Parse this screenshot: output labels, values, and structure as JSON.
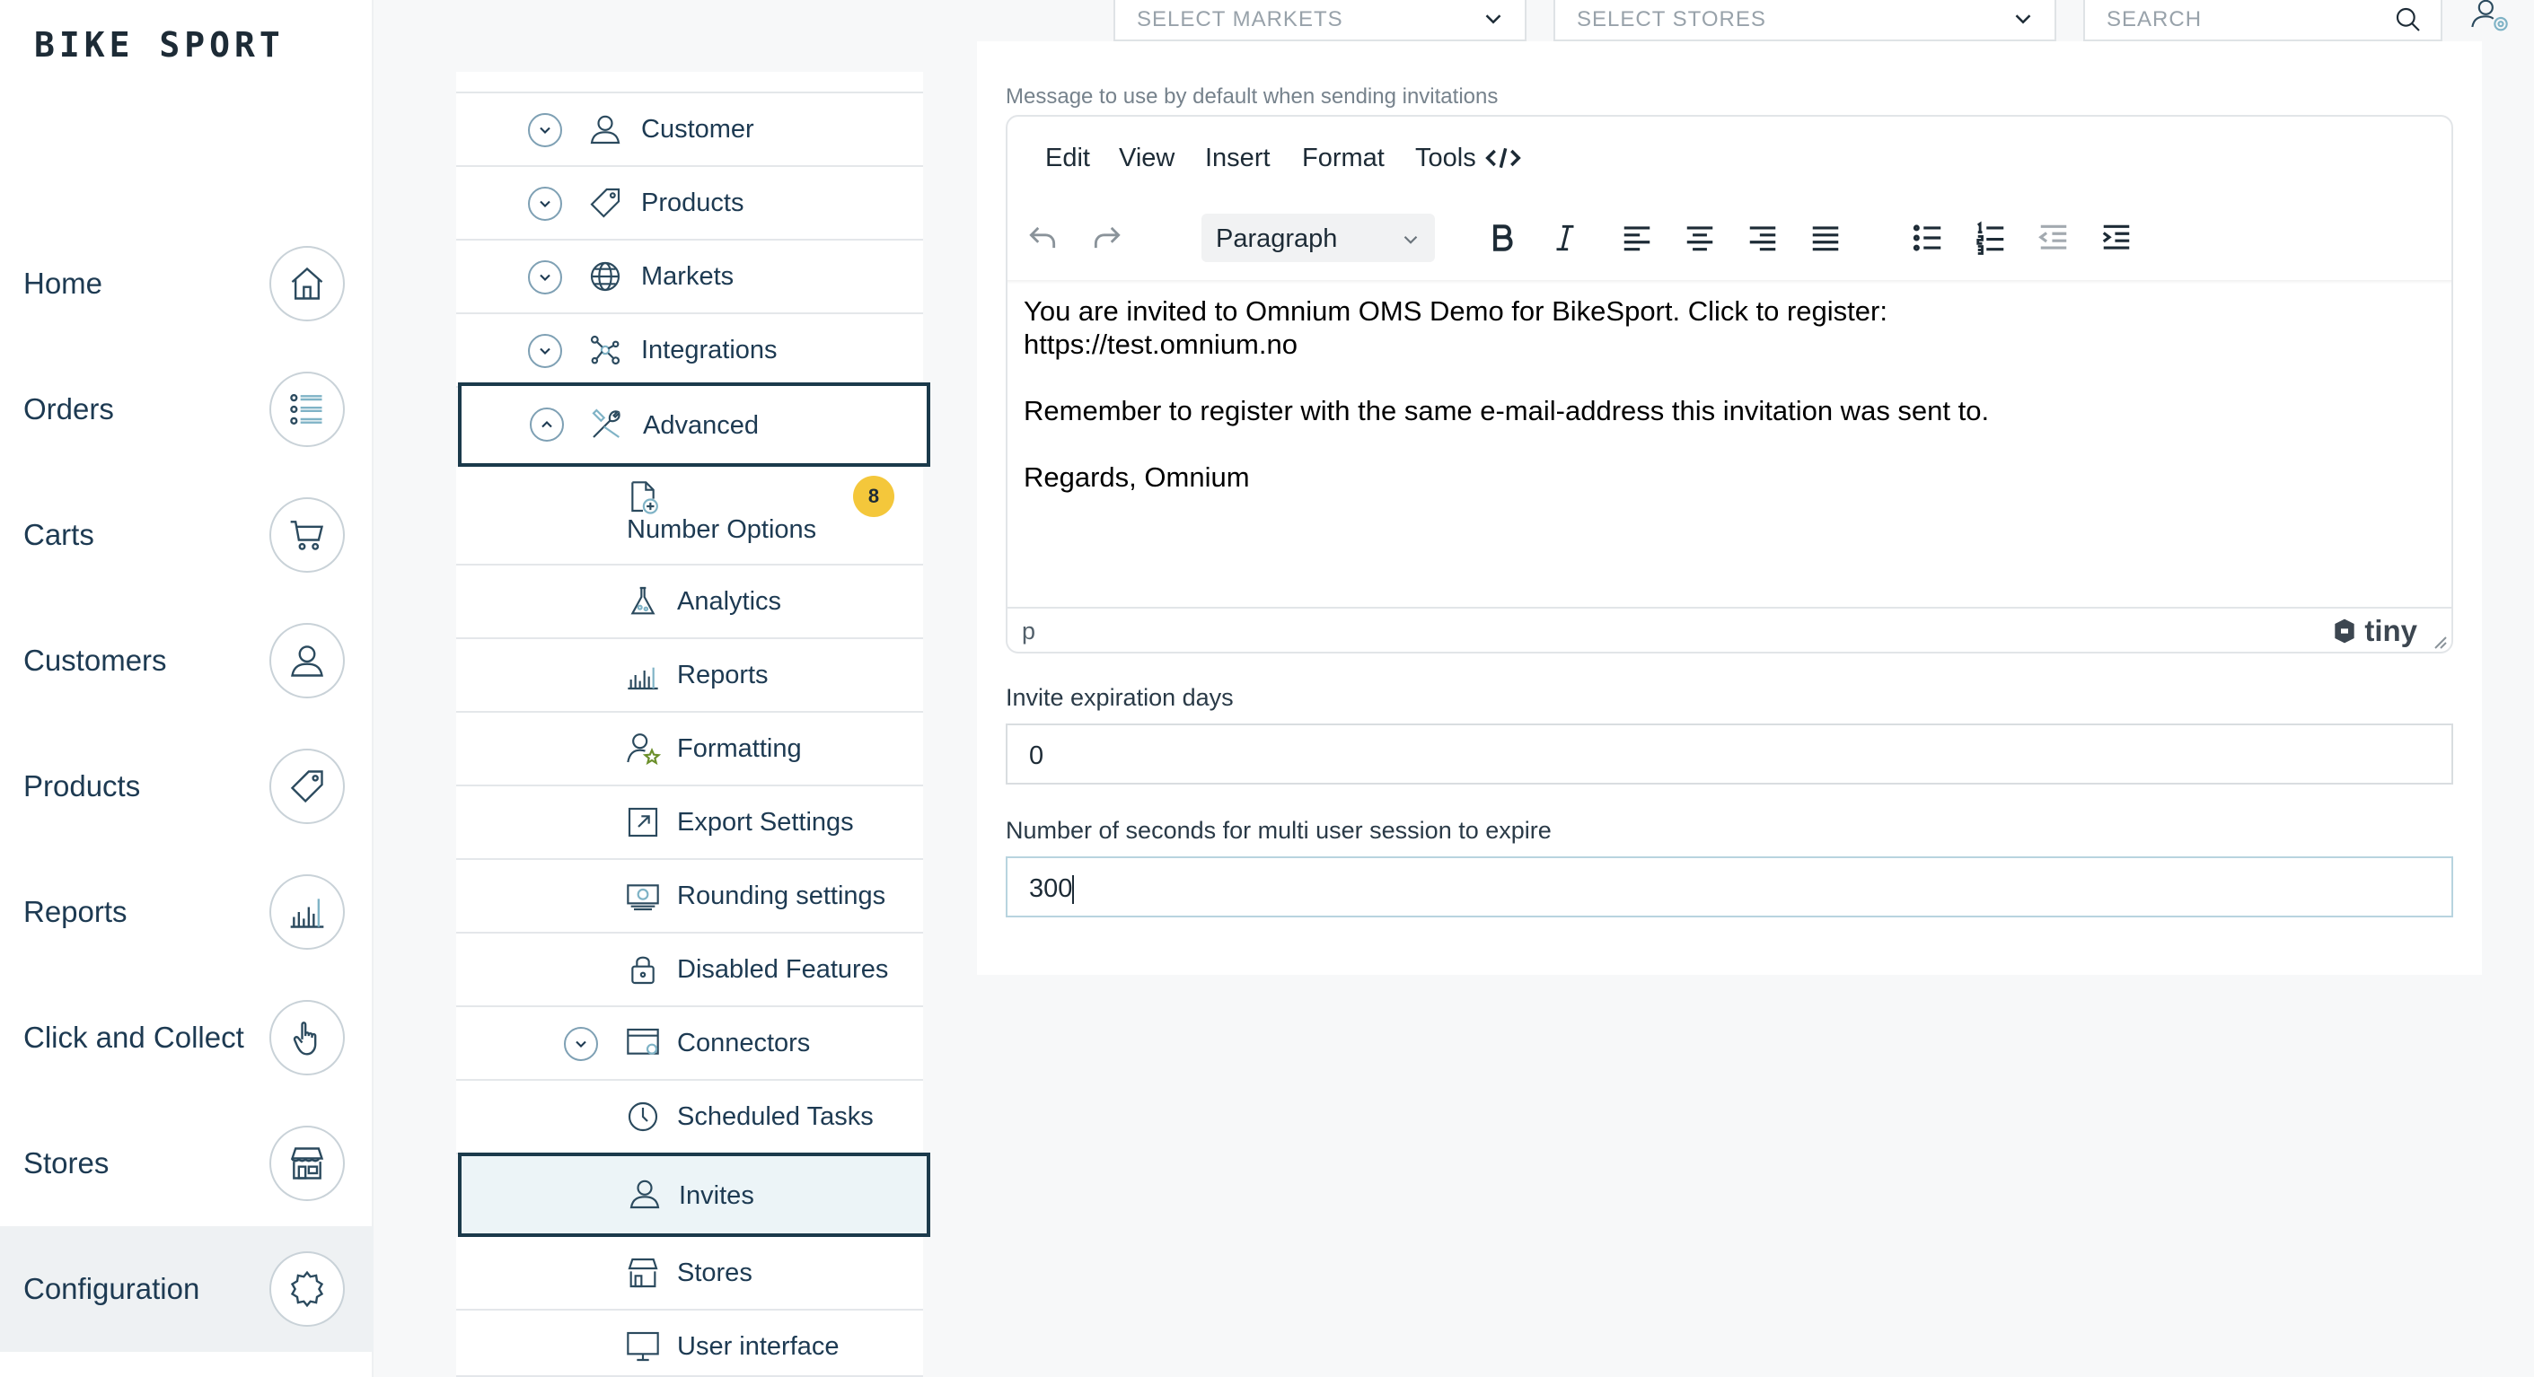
{
  "brand": {
    "logo": "BIKE SPORT"
  },
  "sidebar": {
    "items": [
      {
        "label": "Home",
        "icon": "home-icon"
      },
      {
        "label": "Orders",
        "icon": "list-icon"
      },
      {
        "label": "Carts",
        "icon": "cart-icon"
      },
      {
        "label": "Customers",
        "icon": "user-icon"
      },
      {
        "label": "Products",
        "icon": "tag-icon"
      },
      {
        "label": "Reports",
        "icon": "bar-chart-icon"
      },
      {
        "label": "Click and Collect",
        "icon": "hand-pointer-icon"
      },
      {
        "label": "Stores",
        "icon": "storefront-icon"
      },
      {
        "label": "Configuration",
        "icon": "gear-icon",
        "active": true
      }
    ]
  },
  "topbar": {
    "markets_placeholder": "SELECT MARKETS",
    "stores_placeholder": "SELECT STORES",
    "search_placeholder": "SEARCH"
  },
  "tree": {
    "items": [
      {
        "label": "Customer",
        "icon": "user-icon"
      },
      {
        "label": "Products",
        "icon": "tag-icon"
      },
      {
        "label": "Markets",
        "icon": "globe-icon"
      },
      {
        "label": "Integrations",
        "icon": "integration-icon"
      },
      {
        "label": "Advanced",
        "icon": "tools-icon"
      },
      {
        "label": "Number Options",
        "icon": "document-add-icon",
        "badge": "8"
      },
      {
        "label": "Analytics",
        "icon": "flask-icon"
      },
      {
        "label": "Reports",
        "icon": "bar-chart-icon"
      },
      {
        "label": "Formatting",
        "icon": "user-star-icon"
      },
      {
        "label": "Export Settings",
        "icon": "export-icon"
      },
      {
        "label": "Rounding settings",
        "icon": "money-icon"
      },
      {
        "label": "Disabled Features",
        "icon": "lock-icon"
      },
      {
        "label": "Connectors",
        "icon": "window-icon"
      },
      {
        "label": "Scheduled Tasks",
        "icon": "clock-icon"
      },
      {
        "label": "Invites",
        "icon": "user-icon"
      },
      {
        "label": "Stores",
        "icon": "storefront-icon"
      },
      {
        "label": "User interface",
        "icon": "monitor-icon"
      }
    ]
  },
  "panel": {
    "message_label": "Message to use by default when sending invitations",
    "editor": {
      "menu": [
        "Edit",
        "View",
        "Insert",
        "Format",
        "Tools"
      ],
      "block_format": "Paragraph",
      "content": {
        "line1": "You are invited to Omnium OMS Demo for BikeSport. Click to register:",
        "line2": "https://test.omnium.no",
        "line3": "Remember to register with the same e-mail-address this invitation was sent to.",
        "line4": "Regards, Omnium"
      },
      "status_path": "p",
      "brand": "tiny"
    },
    "expiration_label": "Invite expiration days",
    "expiration_value": "0",
    "session_label": "Number of seconds for multi user session to expire",
    "session_value": "300"
  },
  "colors": {
    "accent": "#1b3a4b",
    "badge": "#f4c73b",
    "highlight": "#ecf4f7"
  }
}
